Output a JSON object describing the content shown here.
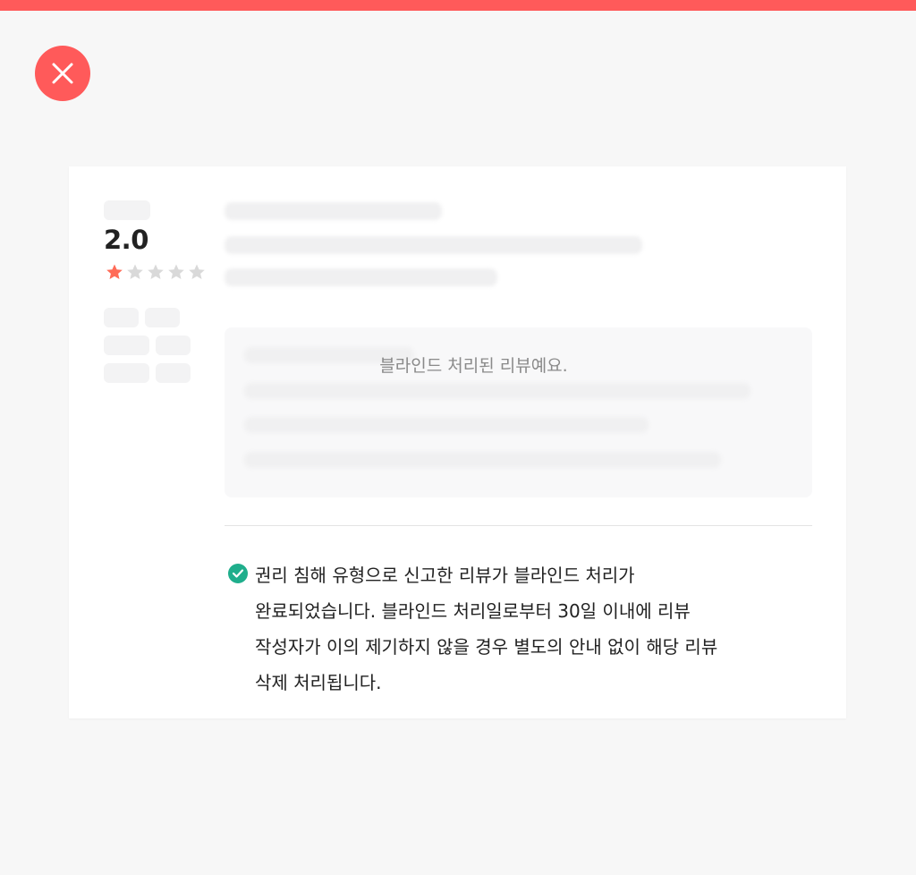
{
  "colors": {
    "accent": "#ff5a5a",
    "star_filled": "#ff6b57",
    "star_empty": "#d9d9d9",
    "success": "#1fae8c"
  },
  "close_button": {
    "icon": "close-icon"
  },
  "review": {
    "rating": "2.0",
    "stars_filled": 1,
    "stars_total": 5,
    "blind_message": "블라인드 처리된 리뷰예요."
  },
  "notice": {
    "icon": "check-circle-icon",
    "lines": [
      "권리 침해 유형으로 신고한 리뷰가 블라인드 처리가",
      "완료되었습니다. 블라인드 처리일로부터 30일 이내에 리뷰",
      "작성자가 이의 제기하지 않을 경우 별도의 안내 없이 해당 리뷰",
      "삭제 처리됩니다."
    ]
  }
}
